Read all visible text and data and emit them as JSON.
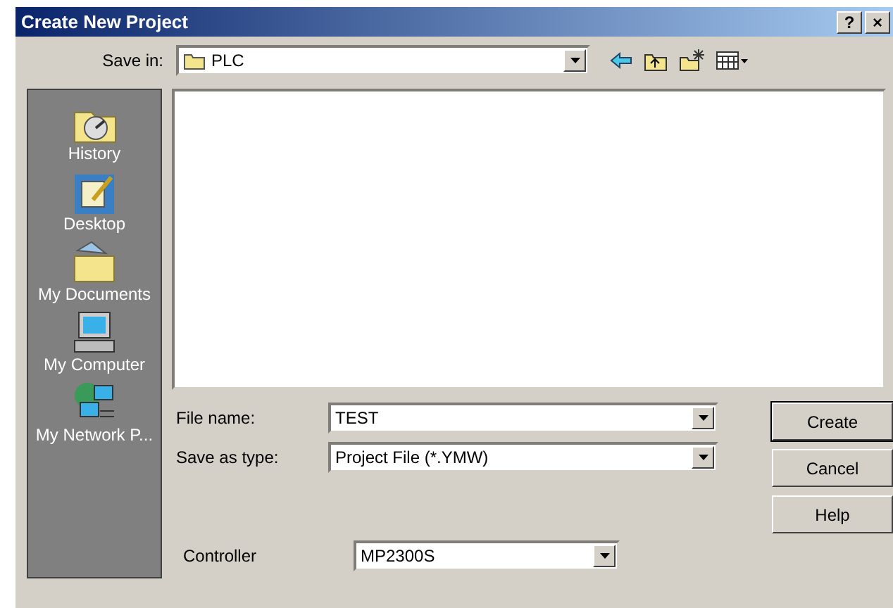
{
  "window": {
    "title": "Create New Project",
    "title_buttons": [
      "?",
      "×"
    ]
  },
  "save_in": {
    "label": "Save in:",
    "value": "PLC"
  },
  "places": [
    {
      "label": "History"
    },
    {
      "label": "Desktop"
    },
    {
      "label": "My Documents"
    },
    {
      "label": "My Computer"
    },
    {
      "label": "My Network P..."
    }
  ],
  "file_name": {
    "label": "File name:",
    "value": "TEST"
  },
  "save_as_type": {
    "label": "Save as type:",
    "value": "Project File (*.YMW)"
  },
  "controller": {
    "label": "Controller",
    "value": "MP2300S"
  },
  "buttons": [
    "Create",
    "Cancel",
    "Help"
  ]
}
